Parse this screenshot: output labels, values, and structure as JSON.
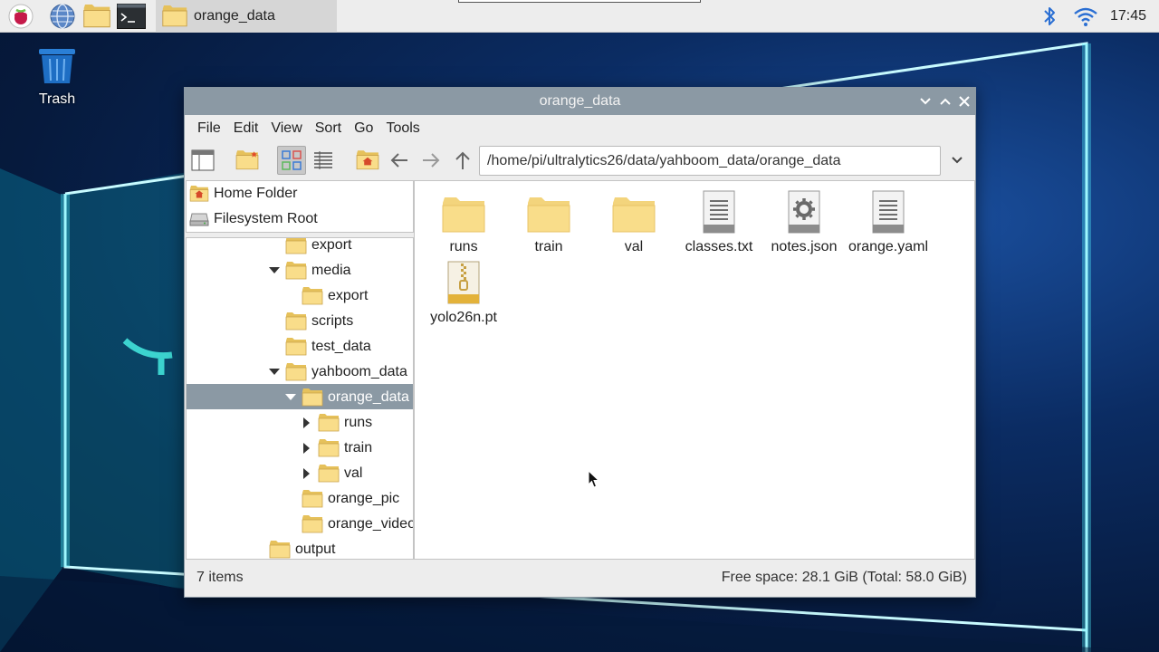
{
  "taskbar": {
    "task_label": "orange_data",
    "clock": "17:45",
    "apps": [
      "raspberry-menu",
      "web-browser",
      "file-manager",
      "terminal"
    ]
  },
  "desktop": {
    "trash_label": "Trash"
  },
  "window": {
    "title": "orange_data",
    "menu": [
      "File",
      "Edit",
      "View",
      "Sort",
      "Go",
      "Tools"
    ],
    "path": "/home/pi/ultralytics26/data/yahboom_data/orange_data",
    "places": [
      {
        "label": "Home Folder",
        "icon": "home-folder-icon"
      },
      {
        "label": "Filesystem Root",
        "icon": "drive-icon"
      }
    ],
    "tree": [
      {
        "label": "export"
      },
      {
        "label": "media"
      },
      {
        "label": "export"
      },
      {
        "label": "scripts"
      },
      {
        "label": "test_data"
      },
      {
        "label": "yahboom_data"
      },
      {
        "label": "orange_data"
      },
      {
        "label": "runs"
      },
      {
        "label": "train"
      },
      {
        "label": "val"
      },
      {
        "label": "orange_pic"
      },
      {
        "label": "orange_video"
      },
      {
        "label": "output"
      }
    ],
    "files": [
      {
        "name": "runs",
        "type": "folder"
      },
      {
        "name": "train",
        "type": "folder"
      },
      {
        "name": "val",
        "type": "folder"
      },
      {
        "name": "classes.txt",
        "type": "text"
      },
      {
        "name": "notes.json",
        "type": "config"
      },
      {
        "name": "orange.yaml",
        "type": "text"
      },
      {
        "name": "yolo26n.pt",
        "type": "archive"
      }
    ],
    "status": {
      "items": "7 items",
      "free_space": "Free space: 28.1 GiB (Total: 58.0 GiB)"
    }
  },
  "colors": {
    "titlebar": "#8b99a4",
    "folder": "#f5d57a",
    "selection": "#8b99a4"
  }
}
